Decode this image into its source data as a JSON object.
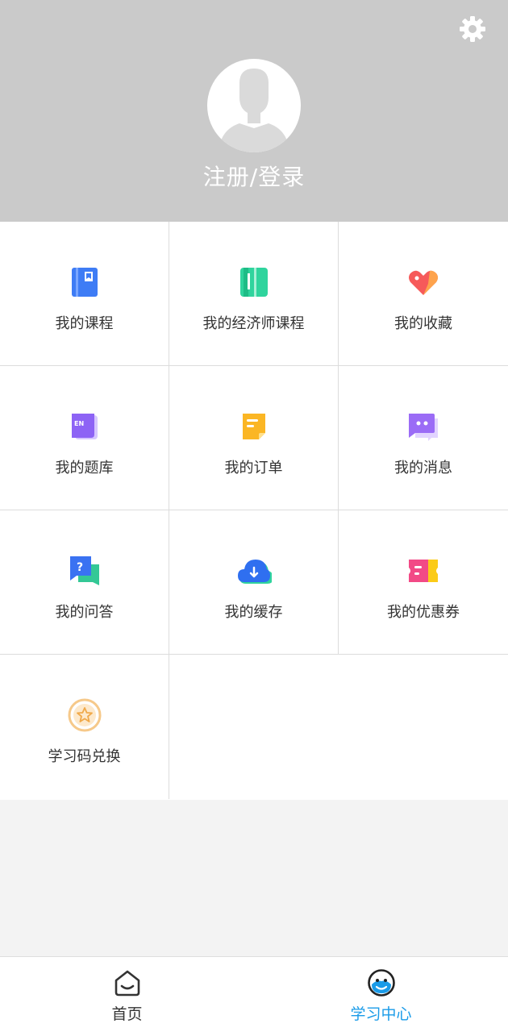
{
  "header": {
    "login_label": "注册/登录",
    "settings_icon": "gear-icon",
    "avatar_icon": "default-avatar-icon"
  },
  "menu": [
    {
      "label": "我的课程",
      "icon": "course-book-icon"
    },
    {
      "label": "我的经济师课程",
      "icon": "economist-book-icon"
    },
    {
      "label": "我的收藏",
      "icon": "heart-icon"
    },
    {
      "label": "我的题库",
      "icon": "question-bank-icon"
    },
    {
      "label": "我的订单",
      "icon": "order-icon"
    },
    {
      "label": "我的消息",
      "icon": "message-icon"
    },
    {
      "label": "我的问答",
      "icon": "qa-icon"
    },
    {
      "label": "我的缓存",
      "icon": "cloud-download-icon"
    },
    {
      "label": "我的优惠券",
      "icon": "coupon-icon"
    },
    {
      "label": "学习码兑换",
      "icon": "star-badge-icon"
    }
  ],
  "tabbar": {
    "tabs": [
      {
        "label": "首页",
        "icon": "home-icon",
        "active": false
      },
      {
        "label": "学习中心",
        "icon": "learning-center-icon",
        "active": true
      }
    ]
  },
  "colors": {
    "header_bg": "#cacaca",
    "active_tab": "#1a9be8",
    "inactive_tab": "#333333",
    "page_bg": "#f3f3f3"
  }
}
